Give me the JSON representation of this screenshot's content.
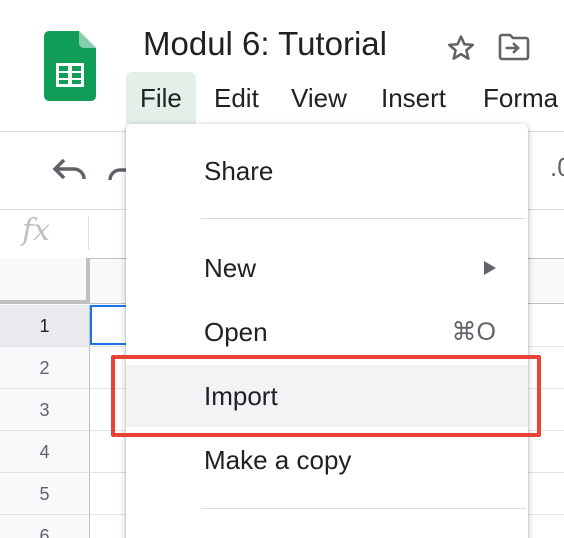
{
  "document": {
    "title": "Modul 6: Tutorial",
    "icons": [
      "sheets-logo",
      "star-icon",
      "move-to-folder-icon"
    ]
  },
  "menubar": {
    "items": [
      {
        "label": "File",
        "active": true
      },
      {
        "label": "Edit"
      },
      {
        "label": "View"
      },
      {
        "label": "Insert"
      },
      {
        "label": "Forma"
      }
    ]
  },
  "toolbar": {
    "icons": [
      "undo-icon",
      "redo-icon"
    ],
    "right_text": ".0"
  },
  "formula_bar": {
    "fx_label": "fx"
  },
  "grid": {
    "row_numbers": [
      "1",
      "2",
      "3",
      "4",
      "5",
      "6"
    ],
    "selected_row": "1"
  },
  "file_menu": {
    "share": "Share",
    "new": "New",
    "open": "Open",
    "open_shortcut": "⌘O",
    "import": "Import",
    "make_copy": "Make a copy"
  },
  "colors": {
    "sheets_green": "#0f9d58",
    "menu_active_bg": "#e3f0e8",
    "highlight_red": "#ea4335",
    "selection_blue": "#1a73e8"
  }
}
